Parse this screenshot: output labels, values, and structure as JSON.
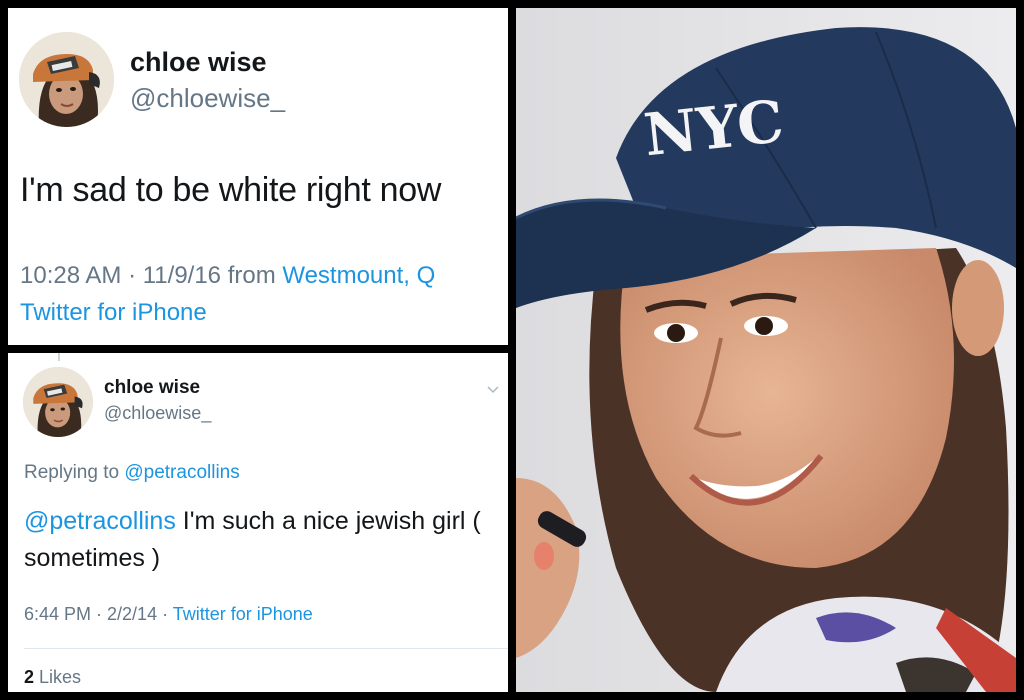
{
  "tweet1": {
    "display_name": "chloe wise",
    "handle": "@chloewise_",
    "text": "I'm sad to be white right now",
    "time_date": "10:28 AM · 11/9/16 from ",
    "location": "Westmount, Q",
    "source": "Twitter for iPhone"
  },
  "tweet2": {
    "display_name": "chloe wise",
    "handle": "@chloewise_",
    "replying_prefix": "Replying to ",
    "replying_to": "@petracollins",
    "mention": "@petracollins",
    "text": " I'm such a nice jewish girl ( sometimes )",
    "time_date": "6:44 PM · 2/2/14 · ",
    "source": "Twitter for iPhone",
    "likes_count": "2",
    "likes_label": "Likes"
  },
  "photo": {
    "cap_text": "NYC"
  },
  "colors": {
    "link": "#1b95e0",
    "secondary": "#657786",
    "cap": "#233a5e"
  }
}
